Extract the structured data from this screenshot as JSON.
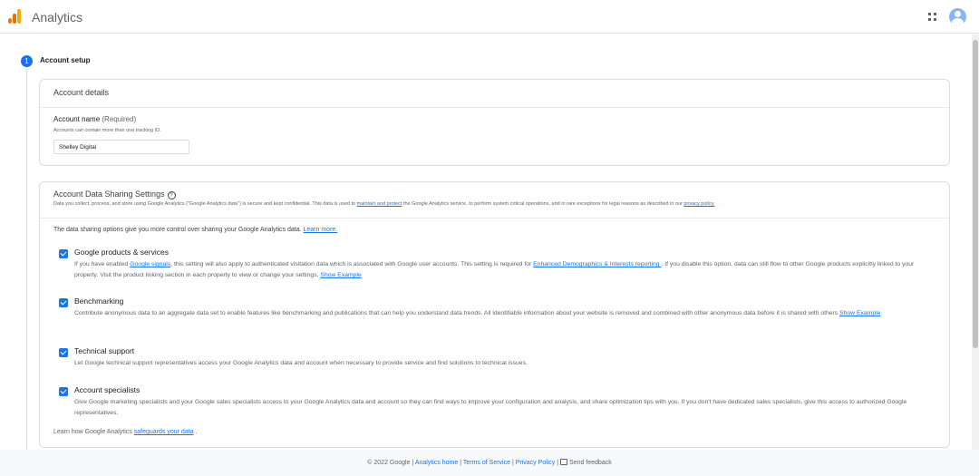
{
  "header": {
    "app_title": "Analytics",
    "logo_icon": "analytics-logo-icon",
    "apps_icon": "apps-grid-icon",
    "avatar_icon": "account-avatar-icon"
  },
  "stepper": {
    "step_number": "1",
    "step_title": "Account setup"
  },
  "account_details": {
    "title": "Account details",
    "name_label": "Account name",
    "name_required": "(Required)",
    "name_hint": "Accounts can contain more than one tracking ID.",
    "name_value": "Shelley Digital"
  },
  "sharing": {
    "title": "Account Data Sharing Settings",
    "desc_pre": "Data you collect, process, and store using Google Analytics (\"Google Analytics data\") is secure and kept confidential. This data is used to ",
    "desc_link1": "maintain and protect",
    "desc_mid": " the Google Analytics service, to perform system critical operations, and in rare exceptions for legal reasons as described in our ",
    "desc_link2": "privacy policy.",
    "intro_text": "The data sharing options give you more control over sharing your Google Analytics data. ",
    "intro_link": "Learn more.",
    "options": [
      {
        "title": "Google products & services",
        "text_pre": "If you have enabled ",
        "link1": "Google signals",
        "text_mid": ", this setting will also apply to authenticated visitation data which is associated with Google user accounts. This setting is required for ",
        "link2": "Enhanced Demographics & Interests reporting ",
        "text_post": ". If you disable this option, data can still flow to other Google products explicitly linked to your property. Visit the product linking section in each property to view or change your settings. ",
        "show_example": "Show Example",
        "checked": true
      },
      {
        "title": "Benchmarking",
        "text": "Contribute anonymous data to an aggregate data set to enable features like benchmarking and publications that can help you understand data trends. All identifiable information about your website is removed and combined with other anonymous data before it is shared with others ",
        "show_example": "Show Example",
        "checked": true
      },
      {
        "title": "Technical support",
        "text": "Let Google technical support representatives access your Google Analytics data and account when necessary to provide service and find solutions to technical issues.",
        "checked": true
      },
      {
        "title": "Account specialists",
        "text": "Give Google marketing specialists and your Google sales specialists access to your Google Analytics data and account so they can find ways to improve your configuration and analysis, and share optimization tips with you. If you don't have dedicated sales specialists, give this access to authorized Google representatives.",
        "checked": true
      }
    ],
    "footnote_pre": "Learn how Google Analytics ",
    "footnote_link": "safeguards your data",
    "footnote_post": " ."
  },
  "footer": {
    "copyright": "© 2022 Google",
    "sep": " | ",
    "analytics_home": "Analytics home",
    "terms": "Terms of Service",
    "privacy": "Privacy Policy",
    "feedback": "Send feedback"
  },
  "colors": {
    "accent": "#1a73e8",
    "logo_orange": "#e37400",
    "logo_yellow": "#f9ab00"
  }
}
